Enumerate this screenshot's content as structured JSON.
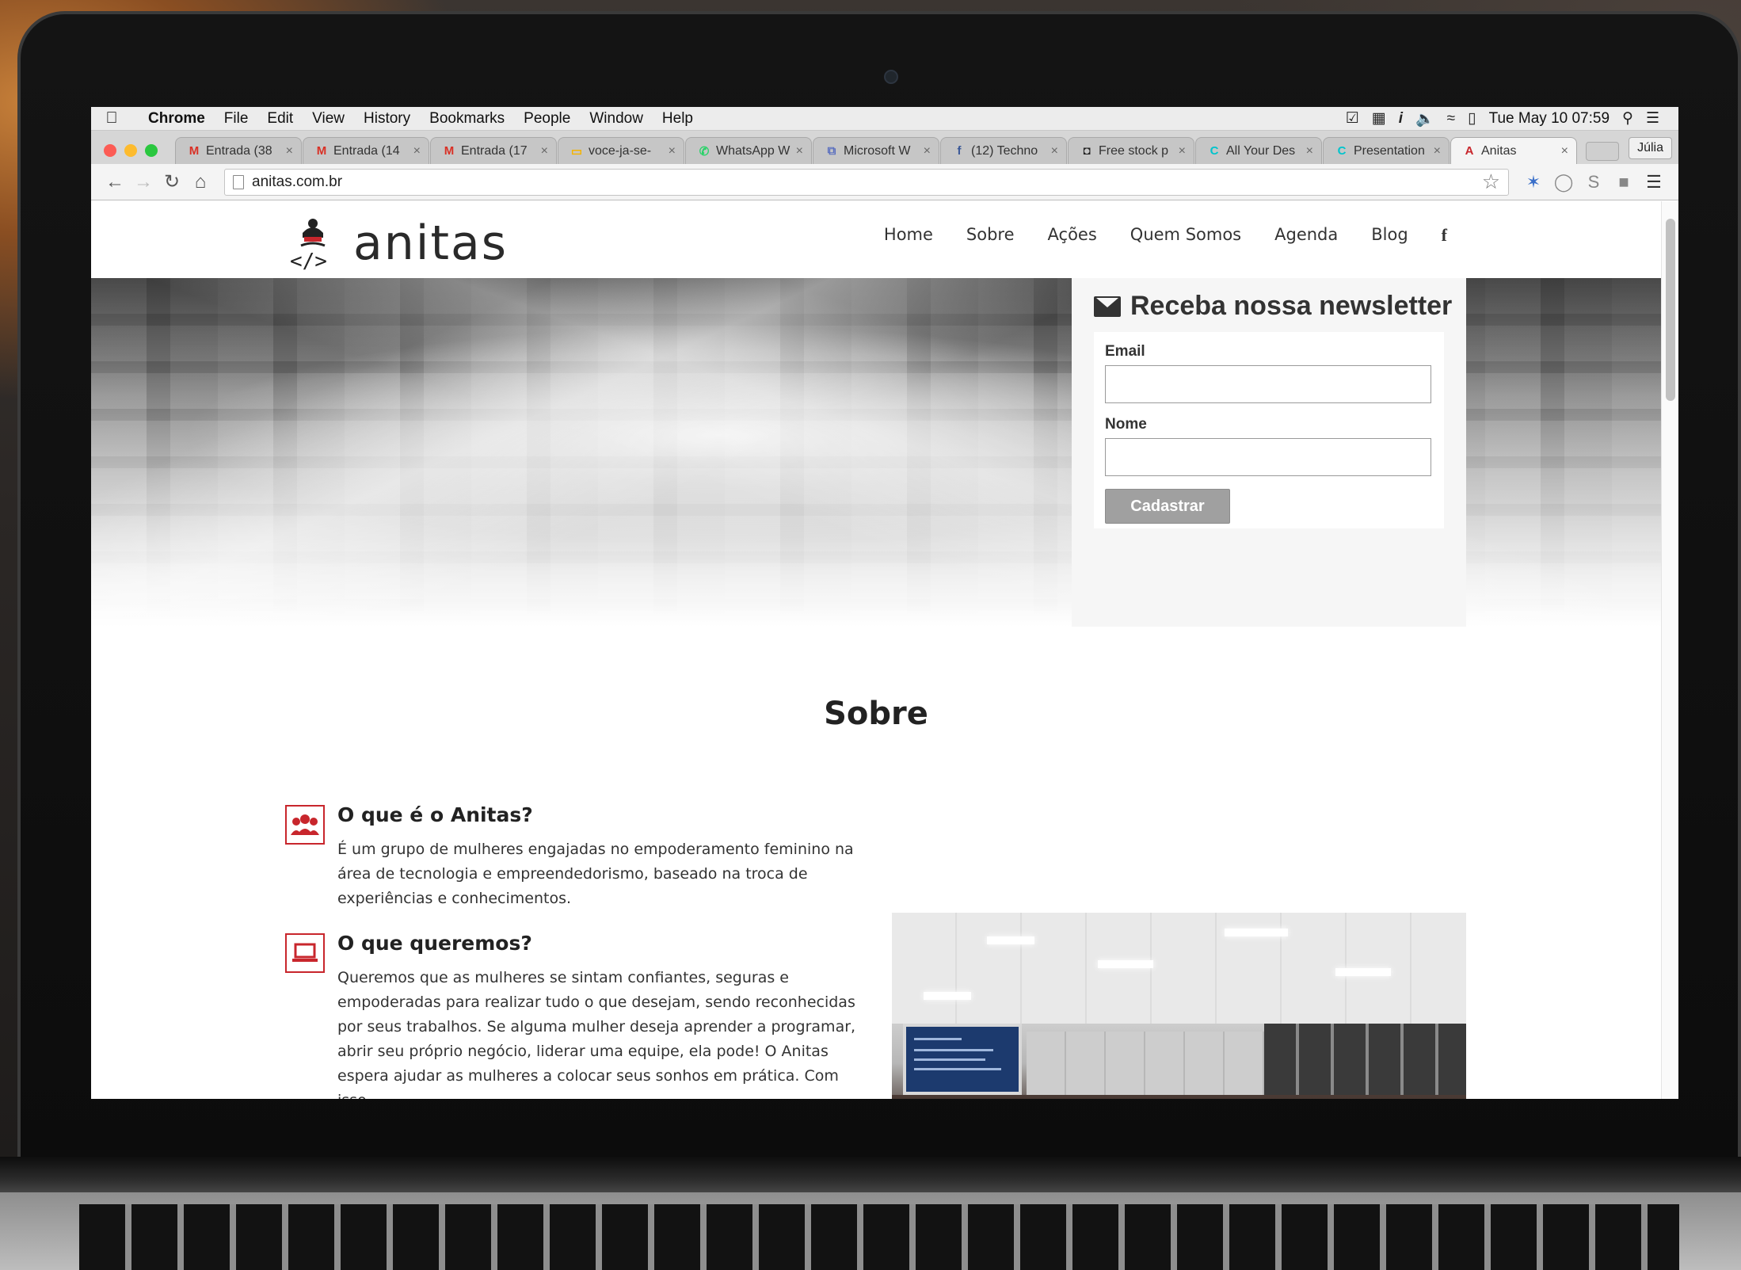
{
  "mac_menubar": {
    "app": "Chrome",
    "menus": [
      "File",
      "Edit",
      "View",
      "History",
      "Bookmarks",
      "People",
      "Window",
      "Help"
    ],
    "clock": "Tue May 10  07:59"
  },
  "tabs": [
    {
      "title": "Entrada (38",
      "favicon": "gmail-icon",
      "color": "#d93025",
      "glyph": "M"
    },
    {
      "title": "Entrada (14",
      "favicon": "gmail-icon",
      "color": "#d93025",
      "glyph": "M"
    },
    {
      "title": "Entrada (17",
      "favicon": "gmail-icon",
      "color": "#d93025",
      "glyph": "M"
    },
    {
      "title": "voce-ja-se-",
      "favicon": "slides-icon",
      "color": "#f4b400",
      "glyph": "▭"
    },
    {
      "title": "WhatsApp W",
      "favicon": "whatsapp-icon",
      "color": "#25d366",
      "glyph": "✆"
    },
    {
      "title": "Microsoft W",
      "favicon": "microsoft-icon",
      "color": "#5b6fbf",
      "glyph": "⧉"
    },
    {
      "title": "(12) Techno",
      "favicon": "facebook-icon",
      "color": "#3b5998",
      "glyph": "f"
    },
    {
      "title": "Free stock p",
      "favicon": "camera-icon",
      "color": "#222222",
      "glyph": "◘"
    },
    {
      "title": "All Your Des",
      "favicon": "canva-icon",
      "color": "#00c4cc",
      "glyph": "C"
    },
    {
      "title": "Presentation",
      "favicon": "canva-icon",
      "color": "#00c4cc",
      "glyph": "C"
    },
    {
      "title": "Anitas",
      "favicon": "anitas-icon",
      "color": "#c8262c",
      "glyph": "A",
      "active": true
    }
  ],
  "profile_name": "Júlia",
  "url": "anitas.com.br",
  "site": {
    "logo_text": "anitas",
    "nav": [
      "Home",
      "Sobre",
      "Ações",
      "Quem Somos",
      "Agenda",
      "Blog",
      "f"
    ],
    "newsletter": {
      "title": "Receba nossa newsletter",
      "email_label": "Email",
      "name_label": "Nome",
      "submit_label": "Cadastrar"
    },
    "section_title": "Sobre",
    "features": [
      {
        "title": "O que é o Anitas?",
        "text": "É um grupo de mulheres engajadas no empoderamento feminino na área de tecnologia e empreendedorismo, baseado na troca de experiências e conhecimentos."
      },
      {
        "title": "O que queremos?",
        "text": "Queremos que as mulheres se sintam confiantes, seguras e empoderadas para realizar tudo o que desejam, sendo reconhecidas por seus trabalhos. Se alguma mulher deseja aprender a programar, abrir seu próprio negócio, liderar uma equipe, ela pode! O Anitas espera ajudar as mulheres a colocar seus sonhos em prática. Com isso,"
      }
    ]
  },
  "colors": {
    "brand_red": "#c8262c",
    "button_gray": "#a0a0a0"
  }
}
